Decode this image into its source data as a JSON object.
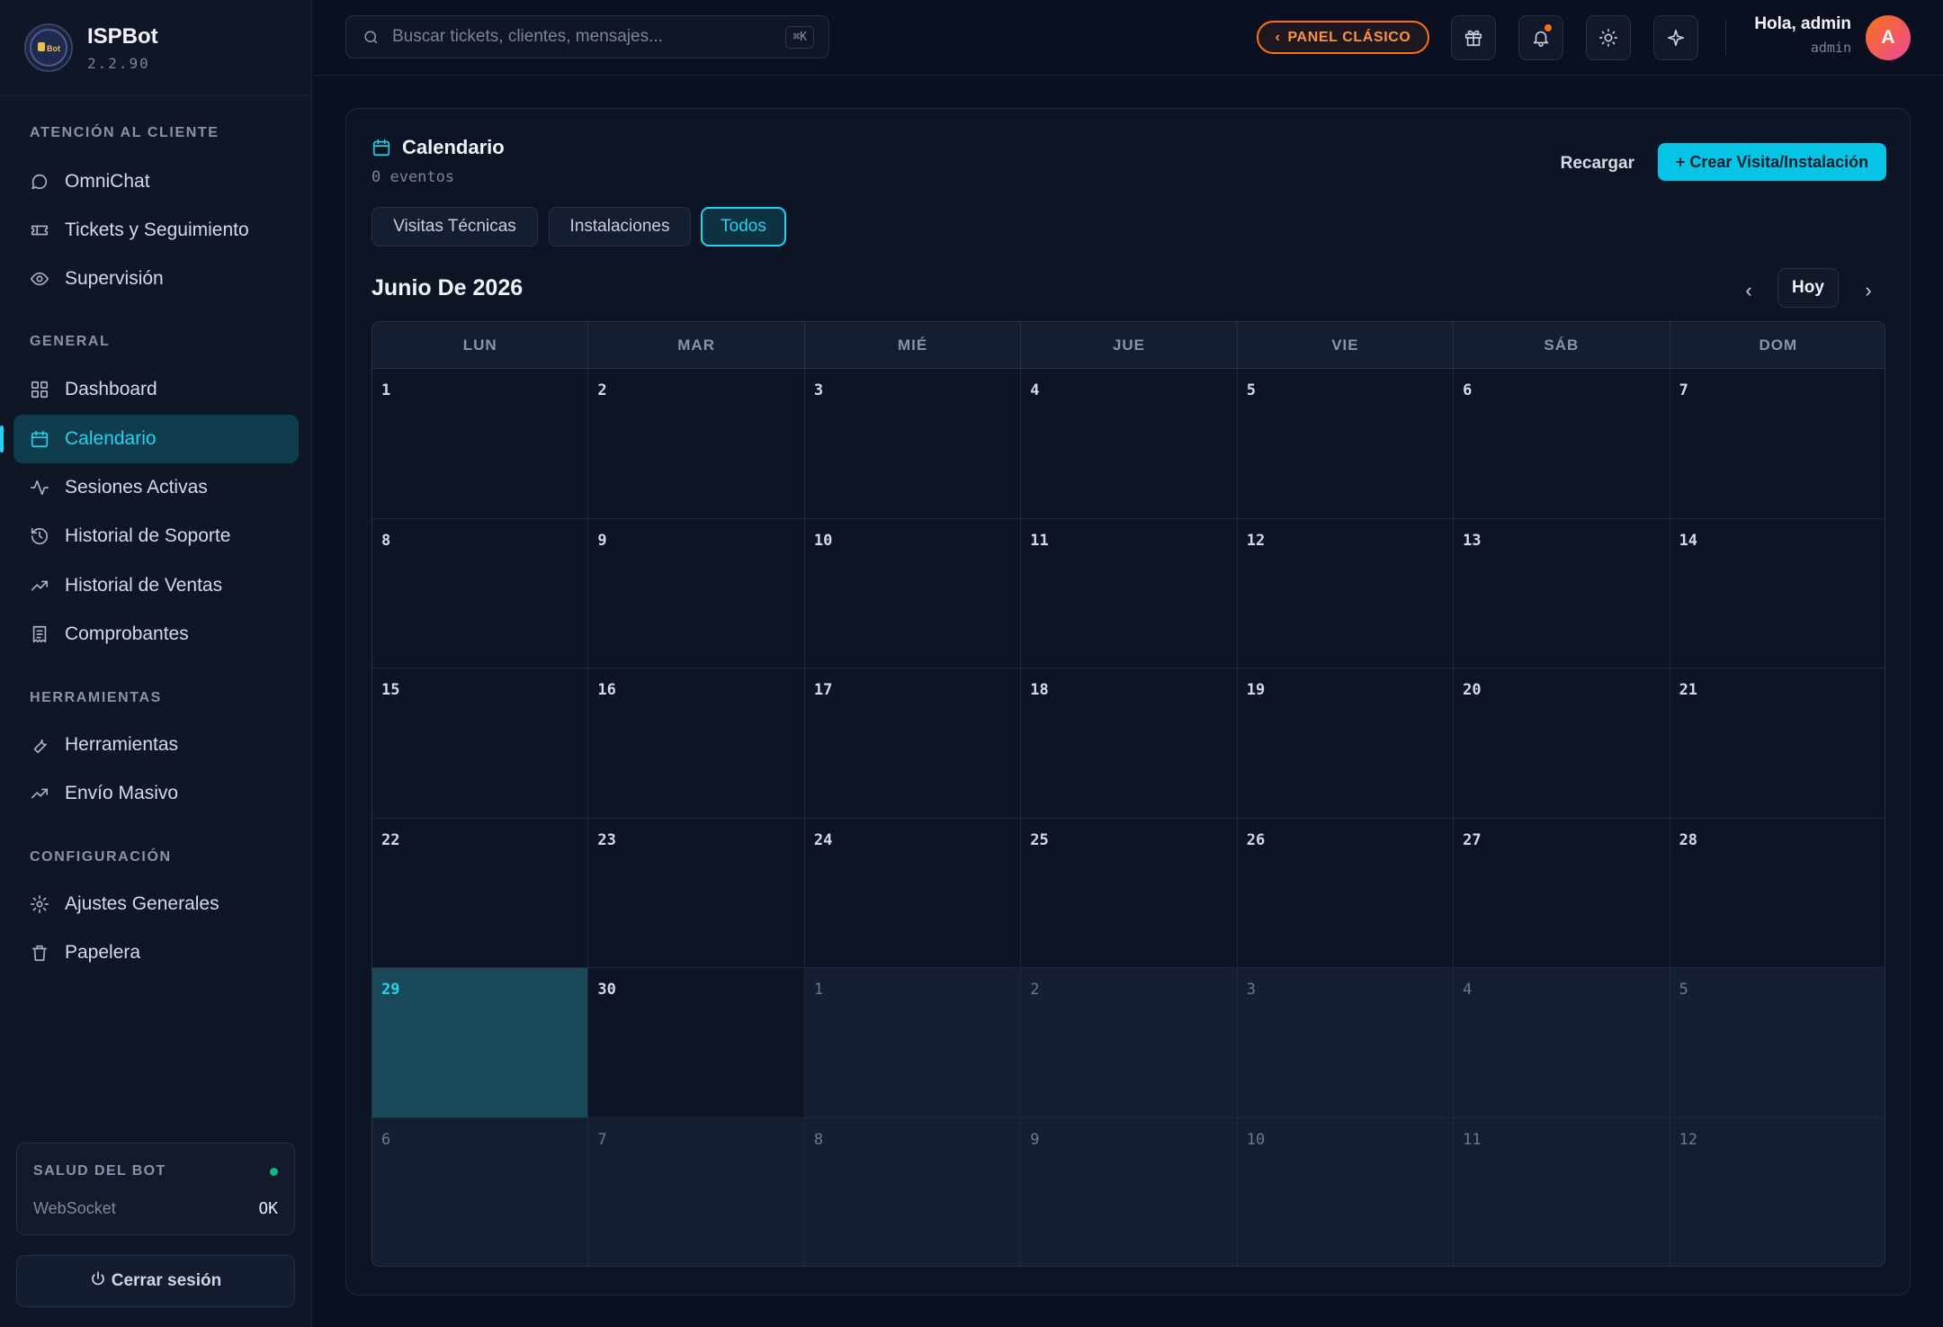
{
  "app": {
    "name": "ISPBot",
    "version": "2.2.90",
    "logo_text": "ISPBot"
  },
  "sidebar": {
    "sections": [
      {
        "title": "ATENCIÓN AL CLIENTE",
        "items": [
          {
            "label": "OmniChat",
            "icon": "chat-bubble-icon"
          },
          {
            "label": "Tickets y Seguimiento",
            "icon": "ticket-icon"
          },
          {
            "label": "Supervisión",
            "icon": "eye-icon"
          }
        ]
      },
      {
        "title": "GENERAL",
        "items": [
          {
            "label": "Dashboard",
            "icon": "grid-icon"
          },
          {
            "label": "Calendario",
            "icon": "calendar-icon",
            "active": true
          },
          {
            "label": "Sesiones Activas",
            "icon": "activity-icon"
          },
          {
            "label": "Historial de Soporte",
            "icon": "history-icon"
          },
          {
            "label": "Historial de Ventas",
            "icon": "trending-up-icon"
          },
          {
            "label": "Comprobantes",
            "icon": "receipt-icon"
          }
        ]
      },
      {
        "title": "HERRAMIENTAS",
        "items": [
          {
            "label": "Herramientas",
            "icon": "wrench-icon"
          },
          {
            "label": "Envío Masivo",
            "icon": "trending-up-icon"
          }
        ]
      },
      {
        "title": "CONFIGURACIÓN",
        "items": [
          {
            "label": "Ajustes Generales",
            "icon": "gear-icon"
          },
          {
            "label": "Papelera",
            "icon": "trash-icon"
          }
        ]
      }
    ],
    "health": {
      "title": "SALUD DEL BOT",
      "label": "WebSocket",
      "value": "OK",
      "status_color": "#10b981"
    },
    "logout_label": "Cerrar sesión"
  },
  "topbar": {
    "search_placeholder": "Buscar tickets, clientes, mensajes...",
    "shortcut": "⌘K",
    "classic_label": "PANEL CLÁSICO",
    "greeting": "Hola, admin",
    "role": "admin",
    "avatar_initial": "A"
  },
  "calendar": {
    "title": "Calendario",
    "subtitle": "0 eventos",
    "reload_label": "Recargar",
    "create_label": "+ Crear Visita/Instalación",
    "filters": [
      {
        "label": "Visitas Técnicas",
        "active": false
      },
      {
        "label": "Instalaciones",
        "active": false
      },
      {
        "label": "Todos",
        "active": true
      }
    ],
    "month_label": "Junio De 2026",
    "today_label": "Hoy",
    "prev_label": "‹",
    "next_label": "›",
    "weekdays": [
      "LUN",
      "MAR",
      "MIÉ",
      "JUE",
      "VIE",
      "SÁB",
      "DOM"
    ],
    "weeks": [
      [
        {
          "d": "1"
        },
        {
          "d": "2"
        },
        {
          "d": "3"
        },
        {
          "d": "4"
        },
        {
          "d": "5"
        },
        {
          "d": "6"
        },
        {
          "d": "7"
        }
      ],
      [
        {
          "d": "8"
        },
        {
          "d": "9"
        },
        {
          "d": "10"
        },
        {
          "d": "11"
        },
        {
          "d": "12"
        },
        {
          "d": "13"
        },
        {
          "d": "14"
        }
      ],
      [
        {
          "d": "15"
        },
        {
          "d": "16"
        },
        {
          "d": "17"
        },
        {
          "d": "18"
        },
        {
          "d": "19"
        },
        {
          "d": "20"
        },
        {
          "d": "21"
        }
      ],
      [
        {
          "d": "22"
        },
        {
          "d": "23"
        },
        {
          "d": "24"
        },
        {
          "d": "25"
        },
        {
          "d": "26"
        },
        {
          "d": "27"
        },
        {
          "d": "28"
        }
      ],
      [
        {
          "d": "29",
          "today": true
        },
        {
          "d": "30"
        },
        {
          "d": "1",
          "other": true
        },
        {
          "d": "2",
          "other": true
        },
        {
          "d": "3",
          "other": true
        },
        {
          "d": "4",
          "other": true
        },
        {
          "d": "5",
          "other": true
        }
      ],
      [
        {
          "d": "6",
          "other": true
        },
        {
          "d": "7",
          "other": true
        },
        {
          "d": "8",
          "other": true
        },
        {
          "d": "9",
          "other": true
        },
        {
          "d": "10",
          "other": true
        },
        {
          "d": "11",
          "other": true
        },
        {
          "d": "12",
          "other": true
        }
      ]
    ],
    "accent_color": "#22d3ee"
  }
}
